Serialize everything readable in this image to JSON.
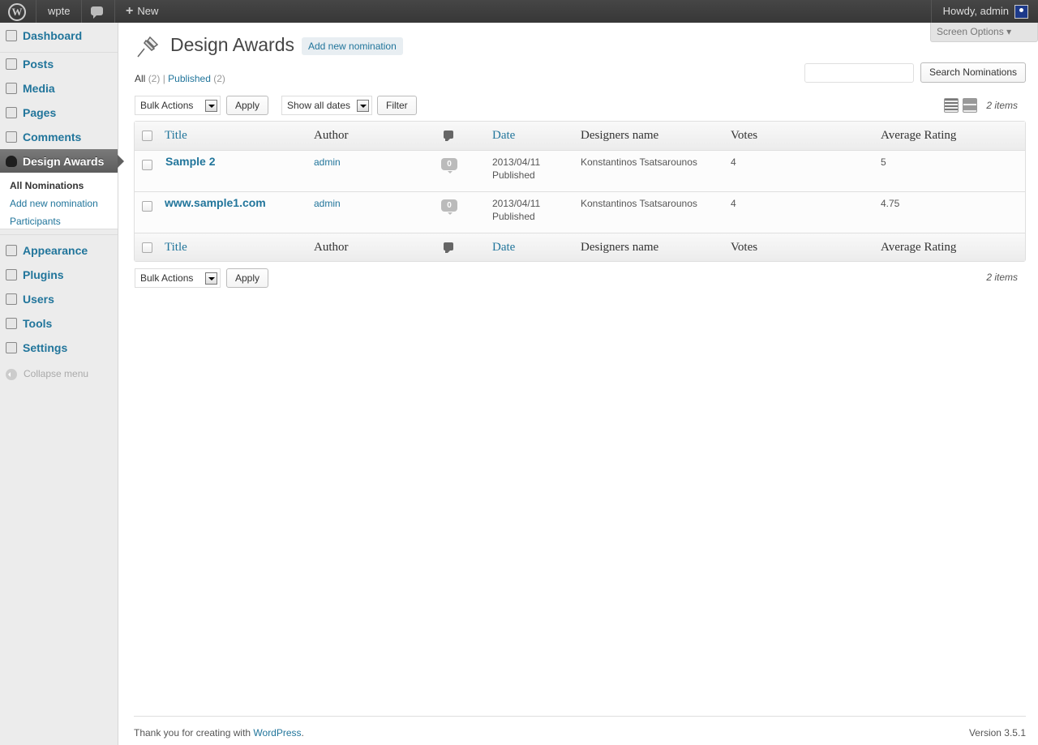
{
  "adminbar": {
    "site_name": "wpte",
    "new_label": "New",
    "howdy": "Howdy, admin"
  },
  "sidebar": {
    "items": [
      {
        "label": "Dashboard"
      },
      {
        "label": "Posts"
      },
      {
        "label": "Media"
      },
      {
        "label": "Pages"
      },
      {
        "label": "Comments"
      },
      {
        "label": "Design Awards"
      },
      {
        "label": "Appearance"
      },
      {
        "label": "Plugins"
      },
      {
        "label": "Users"
      },
      {
        "label": "Tools"
      },
      {
        "label": "Settings"
      }
    ],
    "submenu": [
      "All Nominations",
      "Add new nomination",
      "Participants"
    ],
    "collapse": "Collapse menu"
  },
  "header": {
    "title": "Design Awards",
    "add_new": "Add new nomination",
    "screen_options": "Screen Options"
  },
  "filters": {
    "all": "All",
    "all_count": "(2)",
    "sep": "|",
    "published": "Published",
    "published_count": "(2)"
  },
  "search": {
    "button": "Search Nominations"
  },
  "toolbar": {
    "bulk_actions": "Bulk Actions",
    "apply": "Apply",
    "dates": "Show all dates",
    "filter": "Filter",
    "items_count": "2 items"
  },
  "table": {
    "columns": {
      "title": "Title",
      "author": "Author",
      "date": "Date",
      "designers": "Designers name",
      "votes": "Votes",
      "rating": "Average Rating"
    },
    "rows": [
      {
        "title": "Sample 2",
        "author": "admin",
        "comments": "0",
        "date": "2013/04/11",
        "status": "Published",
        "designers": "Konstantinos Tsatsarounos",
        "votes": "4",
        "rating": "5"
      },
      {
        "title": "www.sample1.com",
        "author": "admin",
        "comments": "0",
        "date": "2013/04/11",
        "status": "Published",
        "designers": "Konstantinos Tsatsarounos",
        "votes": "4",
        "rating": "4.75"
      }
    ]
  },
  "footer": {
    "thanks": "Thank you for creating with ",
    "wordpress": "WordPress",
    "period": ".",
    "version": "Version 3.5.1"
  },
  "colors": {
    "link": "#21759b",
    "adminbar": "#464646",
    "current_menu": "#6d6d6d"
  }
}
